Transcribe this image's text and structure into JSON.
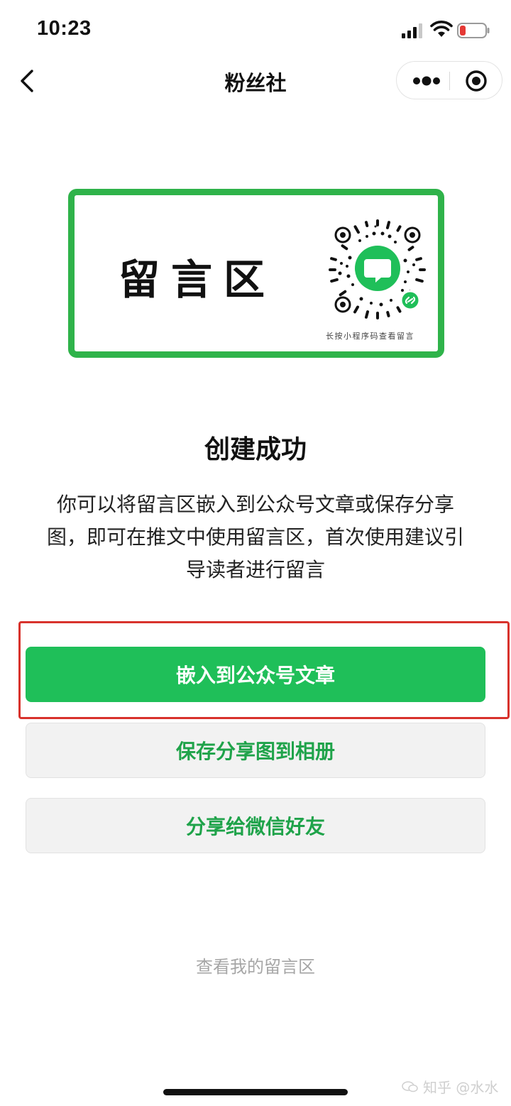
{
  "status_bar": {
    "time": "10:23"
  },
  "nav": {
    "title": "粉丝社"
  },
  "card": {
    "title": "留言区",
    "qr_caption": "长按小程序码查看留言"
  },
  "success": {
    "title": "创建成功",
    "description": "你可以将留言区嵌入到公众号文章或保存分享图，即可在推文中使用留言区，首次使用建议引导读者进行留言"
  },
  "buttons": {
    "embed_label": "嵌入到公众号文章",
    "save_label": "保存分享图到相册",
    "share_label": "分享给微信好友"
  },
  "links": {
    "view_my_comments": "查看我的留言区"
  },
  "watermark": {
    "text": "知乎 @水水"
  },
  "colors": {
    "brand_green": "#1fbf59",
    "card_border_green": "#2fb34a",
    "highlight_red": "#d8322c",
    "secondary_text_green": "#1fa34a"
  },
  "icons": {
    "back": "chevron-left-icon",
    "more": "more-dots-icon",
    "close": "target-close-icon",
    "signal": "cellular-signal-icon",
    "wifi": "wifi-icon",
    "battery": "battery-low-icon",
    "qr": "mini-program-code-icon"
  }
}
